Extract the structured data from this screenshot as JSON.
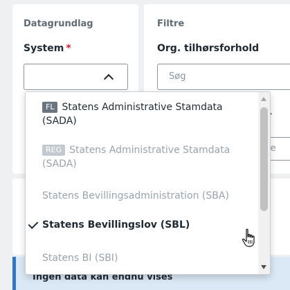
{
  "datagrundlag": {
    "section_title": "Datagrundlag",
    "system_label": "System",
    "required_marker": "*",
    "select_value": ""
  },
  "filtre": {
    "section_title": "Filtre",
    "org_label": "Org. tilhørsforhold",
    "search_placeholder": "Søg",
    "peek_label": "er",
    "peek_input": "sse"
  },
  "dropdown": {
    "options": [
      {
        "badge": "FL",
        "label": "Statens Administrative Stamdata (SADA)",
        "disabled": false,
        "selected": false
      },
      {
        "badge": "REG",
        "label": "Statens Administrative Stamdata (SADA)",
        "disabled": true,
        "selected": false
      },
      {
        "badge": "",
        "label": "Statens Bevillingsadministration (SBA)",
        "disabled": true,
        "selected": false
      },
      {
        "badge": "",
        "label": "Statens Bevillingslov (SBL)",
        "disabled": false,
        "selected": true
      },
      {
        "badge": "",
        "label": "Statens BI (SBI)",
        "disabled": true,
        "selected": false
      }
    ]
  },
  "info": {
    "message": "Ingen data kan endnu vises"
  },
  "icons": {
    "select_chevron": "chevron-up-icon",
    "selected_marker": "check-icon",
    "cursor": "hand-pointer-icon"
  },
  "colors": {
    "required": "#d0202a",
    "info_accent": "#2d79c7",
    "info_background": "#dbe9f6",
    "disabled_text": "#9aa3ac"
  }
}
